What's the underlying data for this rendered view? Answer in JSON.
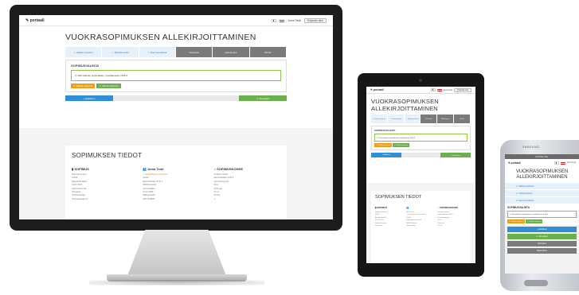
{
  "site": {
    "logo": "✎ portaali",
    "user": "Anna Testi",
    "logout": "Kirjaudu ulos"
  },
  "desktop": {
    "title": "VUOKRASOPIMUKSEN ALLEKIRJOITTAMINEN",
    "steps": [
      {
        "label": "✓ Valitse sopimus",
        "state": "done"
      },
      {
        "label": "✓ Tarkista tiedot",
        "state": "done"
      },
      {
        "label": "✓ Sopimusvalinta",
        "state": "done"
      },
      {
        "label": "Vahvistus",
        "state": "todo"
      },
      {
        "label": "Allekirjoitus",
        "state": "todo"
      },
      {
        "label": "Valmis",
        "state": "todo"
      }
    ],
    "panel_title": "SOPIMUSVALINTA",
    "selected_text": "✔ Olet valinnut sopimuksen | osoitteeseen 10 B 4",
    "btn_change": "✎ Vaihda sopimus",
    "btn_ready": "✔ Valmis sopimus",
    "nav_prev": "« Edellinen",
    "nav_next": "✔ Seuraava",
    "details_title": "SOPIMUKSEN TIEDOT",
    "col1_head": "▮ SOPIMUS",
    "col1_lines": [
      "Sopimusnumero",
      "12345",
      "Alkupäivämäärä",
      "01.07.2015",
      "Sopimuksen tila",
      "Voimassa",
      "Vuokranantaja",
      "Vuokranantaja Oy"
    ],
    "col2_head": "Anna Testi",
    "col2_lines": [
      "✔ Henkilöllisyys tunnistettu",
      "Osoite",
      "Esimerkkikatu 10 B 4",
      "00100 Helsinki",
      "Syntymäaika",
      "01.01.1990",
      "Matkapuhelin",
      "040 1234567"
    ],
    "col3_head": "⌂ SOPIMUSKOHDE",
    "col3_lines": [
      "Kohteen osoite",
      "Esimerkkikatu 10 B 4",
      "Huoneistotyyppi",
      "2h+k",
      "Pinta-ala",
      "52 m²",
      "Kerros",
      "4"
    ]
  },
  "tablet": {
    "title_line1": "VUOKRASOPIMUKSEN",
    "title_line2": "ALLEKIRJOITTAMINEN",
    "panel_title": "SOPIMUSVALINTA",
    "details_title": "SOPIMUKSEN TIEDOT"
  },
  "phone": {
    "brand": "SAMSUNG",
    "title_line1": "VUOKRASOPIMUKSEN",
    "title_line2": "ALLEKIRJOITTAMINEN",
    "steps": [
      "Valitse sopimus",
      "Tarkista tiedot",
      "Sopimusvalinta"
    ],
    "panel_title": "SOPIMUSVALINTA",
    "btn_prev": "« Edellinen",
    "btn_next": "✔ Seuraava",
    "step_4": "Vahvistus",
    "step_5": "Allekirjoitus"
  }
}
